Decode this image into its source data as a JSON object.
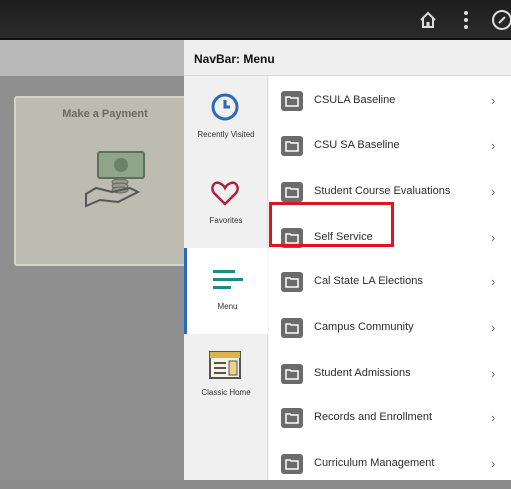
{
  "navbar": {
    "title": "NavBar: Menu"
  },
  "topbar": {
    "icons": [
      "home-icon",
      "kebab-menu-icon",
      "compass-icon"
    ]
  },
  "tile": {
    "title": "Make a Payment",
    "icon": "payment-hand-icon"
  },
  "rail": {
    "items": [
      {
        "label": "Recently Visited",
        "icon": "clock-icon"
      },
      {
        "label": "Favorites",
        "icon": "heart-icon"
      },
      {
        "label": "Menu",
        "icon": "menu-lines-icon",
        "active": true
      },
      {
        "label": "Classic Home",
        "icon": "classic-home-icon"
      }
    ]
  },
  "menu": {
    "items": [
      {
        "label": "CSULA Baseline"
      },
      {
        "label": "CSU SA Baseline"
      },
      {
        "label": "Student Course Evaluations"
      },
      {
        "label": "Self Service",
        "highlighted": true
      },
      {
        "label": "Cal State LA Elections"
      },
      {
        "label": "Campus Community"
      },
      {
        "label": "Student Admissions"
      },
      {
        "label": "Records and Enrollment"
      },
      {
        "label": "Curriculum Management"
      }
    ],
    "chevron": "›"
  },
  "colors": {
    "highlight": "#e0141e",
    "accent": "#2a6ab8",
    "folder": "#6b6b6b"
  }
}
